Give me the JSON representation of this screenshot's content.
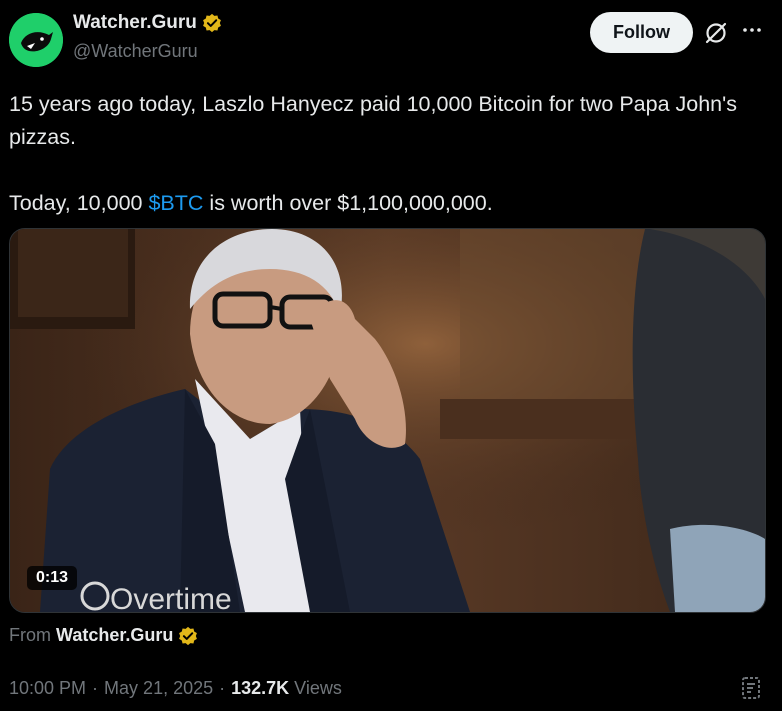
{
  "author": {
    "name": "Watcher.Guru",
    "handle": "@WatcherGuru",
    "avatar_color": "#1fcf6a",
    "verified_badge_color": "#e2b719"
  },
  "actions": {
    "follow_label": "Follow",
    "grok_icon": "grok-icon",
    "more_icon": "more-icon"
  },
  "tweet": {
    "line1": "15 years ago today, Laszlo Hanyecz paid 10,000 Bitcoin for two Papa John's pizzas.",
    "line2_before": "Today, 10,000 ",
    "cashtag": "$BTC",
    "line2_after": " is worth over $1,100,000,000."
  },
  "media": {
    "duration": "0:13",
    "watermark": "Overtime"
  },
  "source": {
    "label": "From",
    "name": "Watcher.Guru"
  },
  "meta": {
    "time": "10:00 PM",
    "separator": "·",
    "date": "May 21, 2025",
    "views_count": "132.7K",
    "views_label": "Views"
  },
  "colors": {
    "accent": "#1d9bf0",
    "muted": "#71767b",
    "text": "#e7e9ea"
  }
}
